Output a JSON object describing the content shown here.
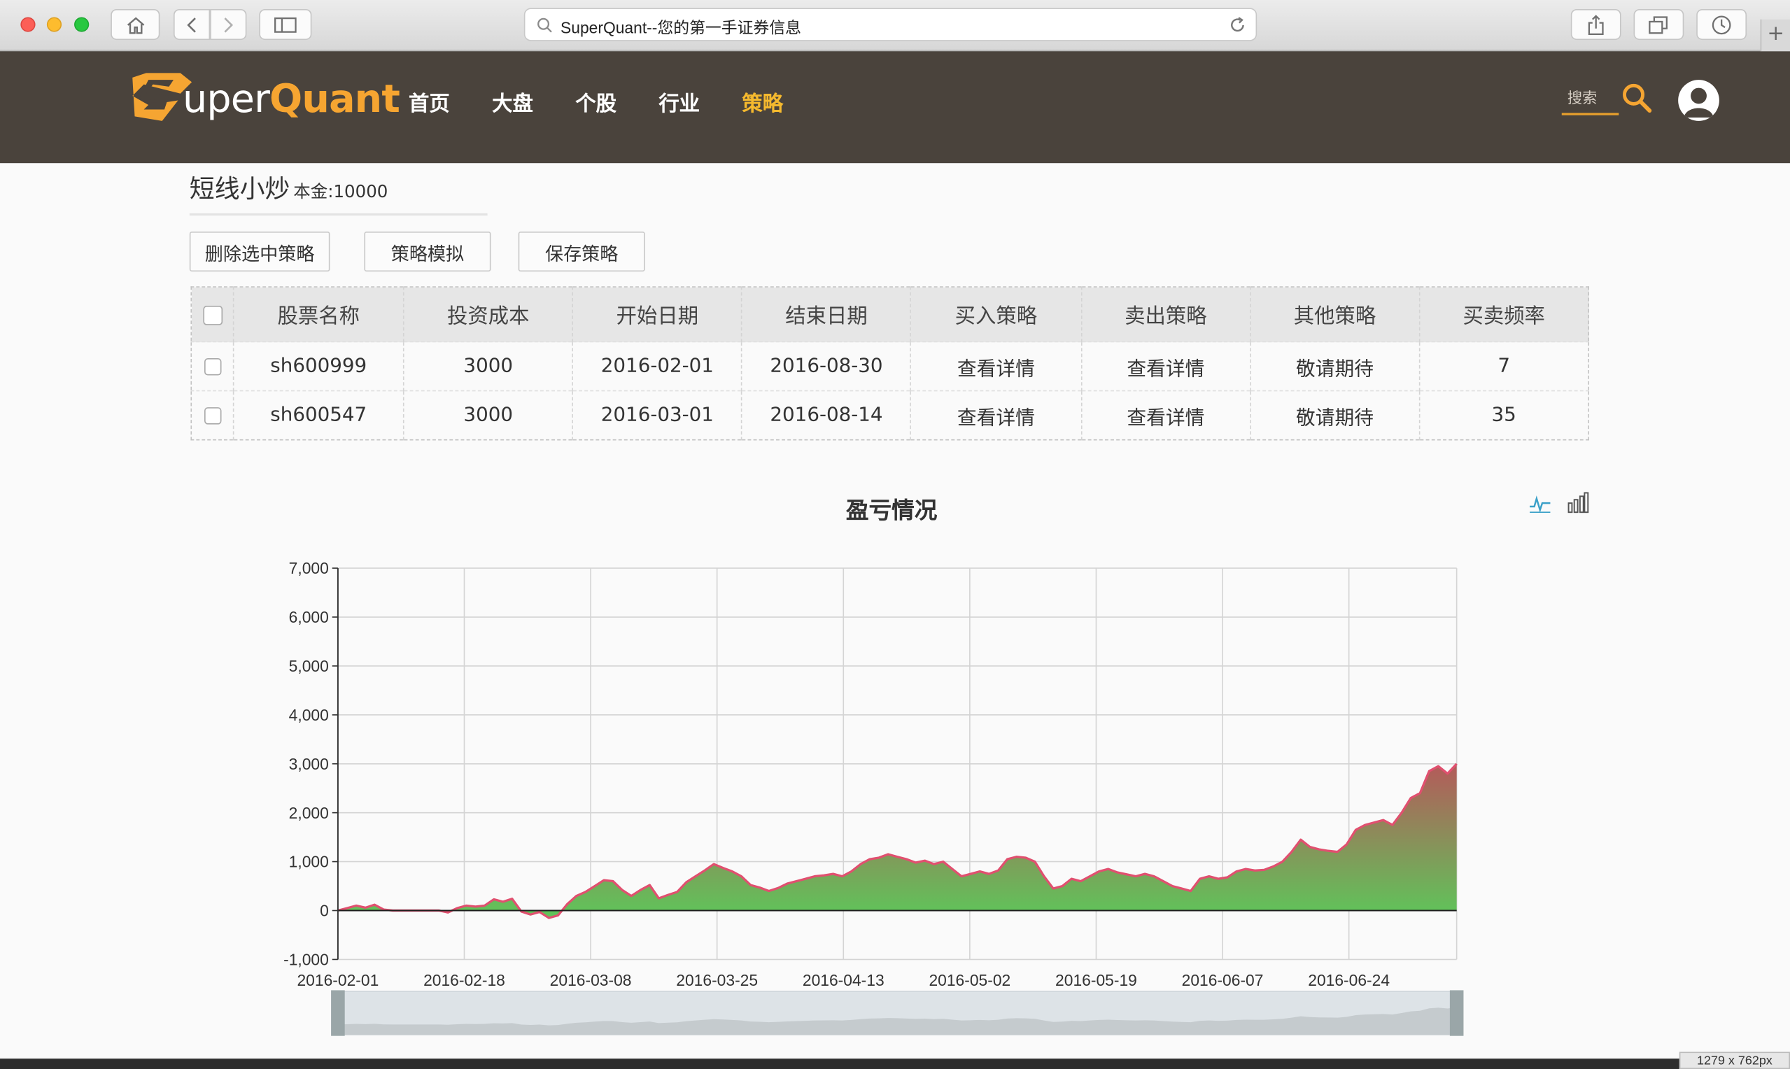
{
  "browser": {
    "address": "SuperQuant--您的第一手证券信息",
    "new_tab": "+",
    "window_size": "1279 x 762px"
  },
  "header": {
    "logo_text_prefix": "S",
    "logo_text_upper": "uper",
    "logo_text_quant": "Quant",
    "nav": [
      {
        "label": "首页",
        "active": false
      },
      {
        "label": "大盘",
        "active": false
      },
      {
        "label": "个股",
        "active": false
      },
      {
        "label": "行业",
        "active": false
      },
      {
        "label": "策略",
        "active": true
      }
    ],
    "search_placeholder": "搜索",
    "accent_color": "#f5b92e",
    "header_bg": "#4a433c"
  },
  "strategy": {
    "title": "短线小炒",
    "capital": "本金:10000"
  },
  "buttons": {
    "delete": "删除选中策略",
    "simulate": "策略模拟",
    "save": "保存策略"
  },
  "table": {
    "headers": [
      "股票名称",
      "投资成本",
      "开始日期",
      "结束日期",
      "买入策略",
      "卖出策略",
      "其他策略",
      "买卖频率"
    ],
    "rows": [
      {
        "name": "sh600999",
        "cost": "3000",
        "start": "2016-02-01",
        "end": "2016-08-30",
        "buy": "查看详情",
        "sell": "查看详情",
        "other": "敬请期待",
        "freq": "7"
      },
      {
        "name": "sh600547",
        "cost": "3000",
        "start": "2016-03-01",
        "end": "2016-08-14",
        "buy": "查看详情",
        "sell": "查看详情",
        "other": "敬请期待",
        "freq": "35"
      }
    ]
  },
  "chart_title": "盈亏情况",
  "chart_data": {
    "type": "area",
    "title": "盈亏情况",
    "xlabel": "",
    "ylabel": "",
    "ylim": [
      -1000,
      7000
    ],
    "yticks": [
      -1000,
      0,
      1000,
      2000,
      3000,
      4000,
      5000,
      6000,
      7000
    ],
    "ytick_labels": [
      "-1,000",
      "0",
      "1,000",
      "2,000",
      "3,000",
      "4,000",
      "5,000",
      "6,000",
      "7,000"
    ],
    "xtick_labels": [
      "2016-02-01",
      "2016-02-18",
      "2016-03-08",
      "2016-03-25",
      "2016-04-13",
      "2016-05-02",
      "2016-05-19",
      "2016-06-07",
      "2016-06-24"
    ],
    "grid": true,
    "line_color": "#e0506f",
    "fill_top_color": "#b45a5a",
    "fill_bottom_color": "#5ec65a",
    "series": [
      {
        "values": [
          0,
          50,
          100,
          60,
          120,
          20,
          0,
          0,
          0,
          0,
          0,
          0,
          -40,
          50,
          100,
          80,
          100,
          230,
          180,
          240,
          -20,
          -80,
          -30,
          -150,
          -100,
          130,
          300,
          380,
          500,
          620,
          600,
          420,
          300,
          420,
          520,
          250,
          320,
          380,
          580,
          700,
          820,
          950,
          870,
          800,
          700,
          520,
          470,
          400,
          460,
          550,
          600,
          650,
          700,
          720,
          750,
          700,
          800,
          950,
          1050,
          1080,
          1150,
          1100,
          1050,
          980,
          1020,
          950,
          1000,
          850,
          700,
          750,
          800,
          750,
          820,
          1050,
          1100,
          1080,
          1000,
          700,
          450,
          500,
          650,
          600,
          700,
          800,
          850,
          780,
          740,
          700,
          750,
          700,
          600,
          500,
          450,
          400,
          650,
          700,
          650,
          680,
          800,
          850,
          820,
          830,
          900,
          1000,
          1200,
          1450,
          1300,
          1250,
          1220,
          1200,
          1350,
          1650,
          1750,
          1800,
          1850,
          1750,
          2000,
          2300,
          2400,
          2850,
          2950,
          2800,
          3000
        ]
      }
    ]
  }
}
